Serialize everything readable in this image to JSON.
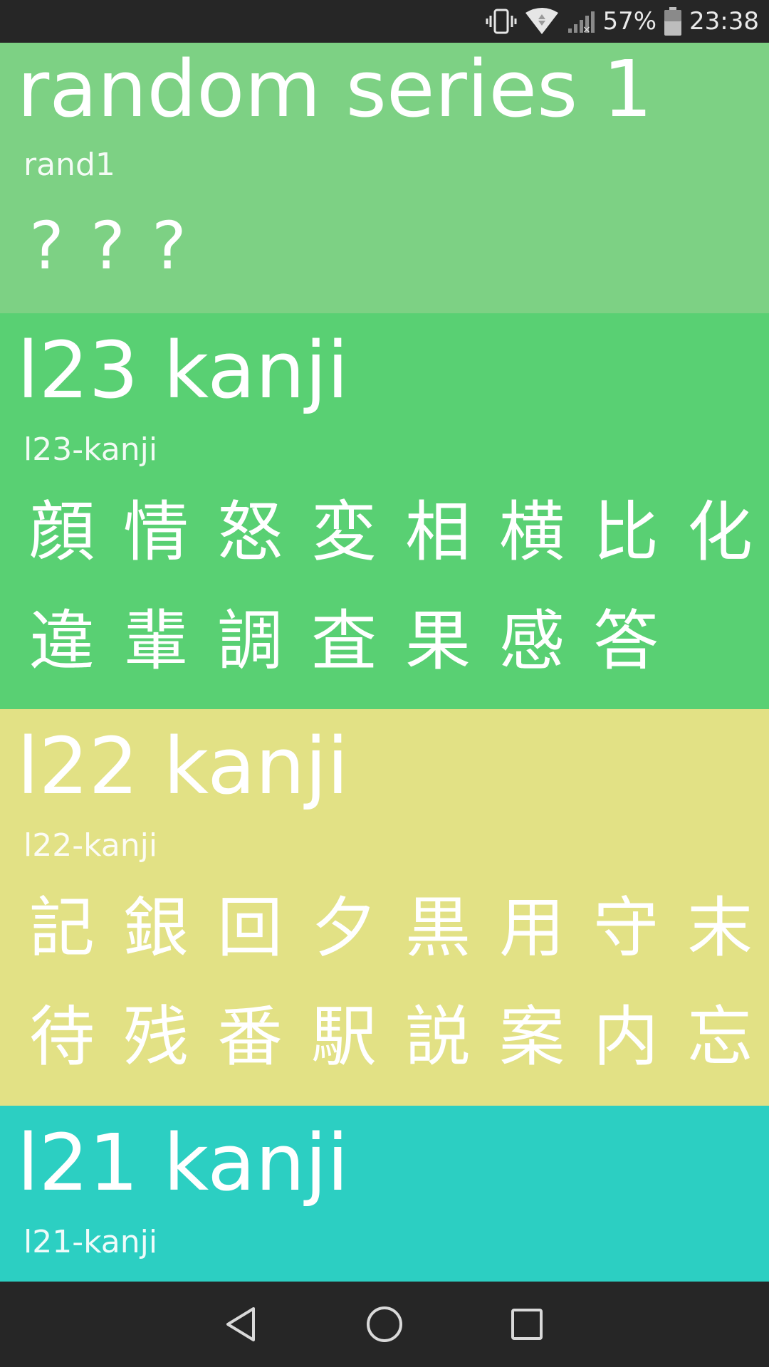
{
  "status_bar": {
    "battery_percent": "57%",
    "time": "23:38",
    "icons": [
      "vibrate-icon",
      "wifi-icon",
      "signal-icon",
      "battery-icon"
    ]
  },
  "sections": [
    {
      "title": "random series 1",
      "slug": "rand1",
      "color": "#7dd184",
      "kanji": [
        "?",
        "?",
        "?"
      ]
    },
    {
      "title": "l23 kanji",
      "slug": "l23-kanji",
      "color": "#59d073",
      "kanji": [
        "顔",
        "情",
        "怒",
        "変",
        "相",
        "横",
        "比",
        "化",
        "違",
        "輩",
        "調",
        "査",
        "果",
        "感",
        "答"
      ]
    },
    {
      "title": "l22 kanji",
      "slug": "l22-kanji",
      "color": "#e2e185",
      "kanji": [
        "記",
        "銀",
        "回",
        "夕",
        "黒",
        "用",
        "守",
        "末",
        "待",
        "残",
        "番",
        "駅",
        "説",
        "案",
        "内",
        "忘"
      ]
    },
    {
      "title": "l21 kanji",
      "slug": "l21-kanji",
      "color": "#2ccfc2",
      "kanji": []
    }
  ],
  "nav_bar": {
    "icons": [
      "back-icon",
      "home-icon",
      "recents-icon"
    ]
  }
}
